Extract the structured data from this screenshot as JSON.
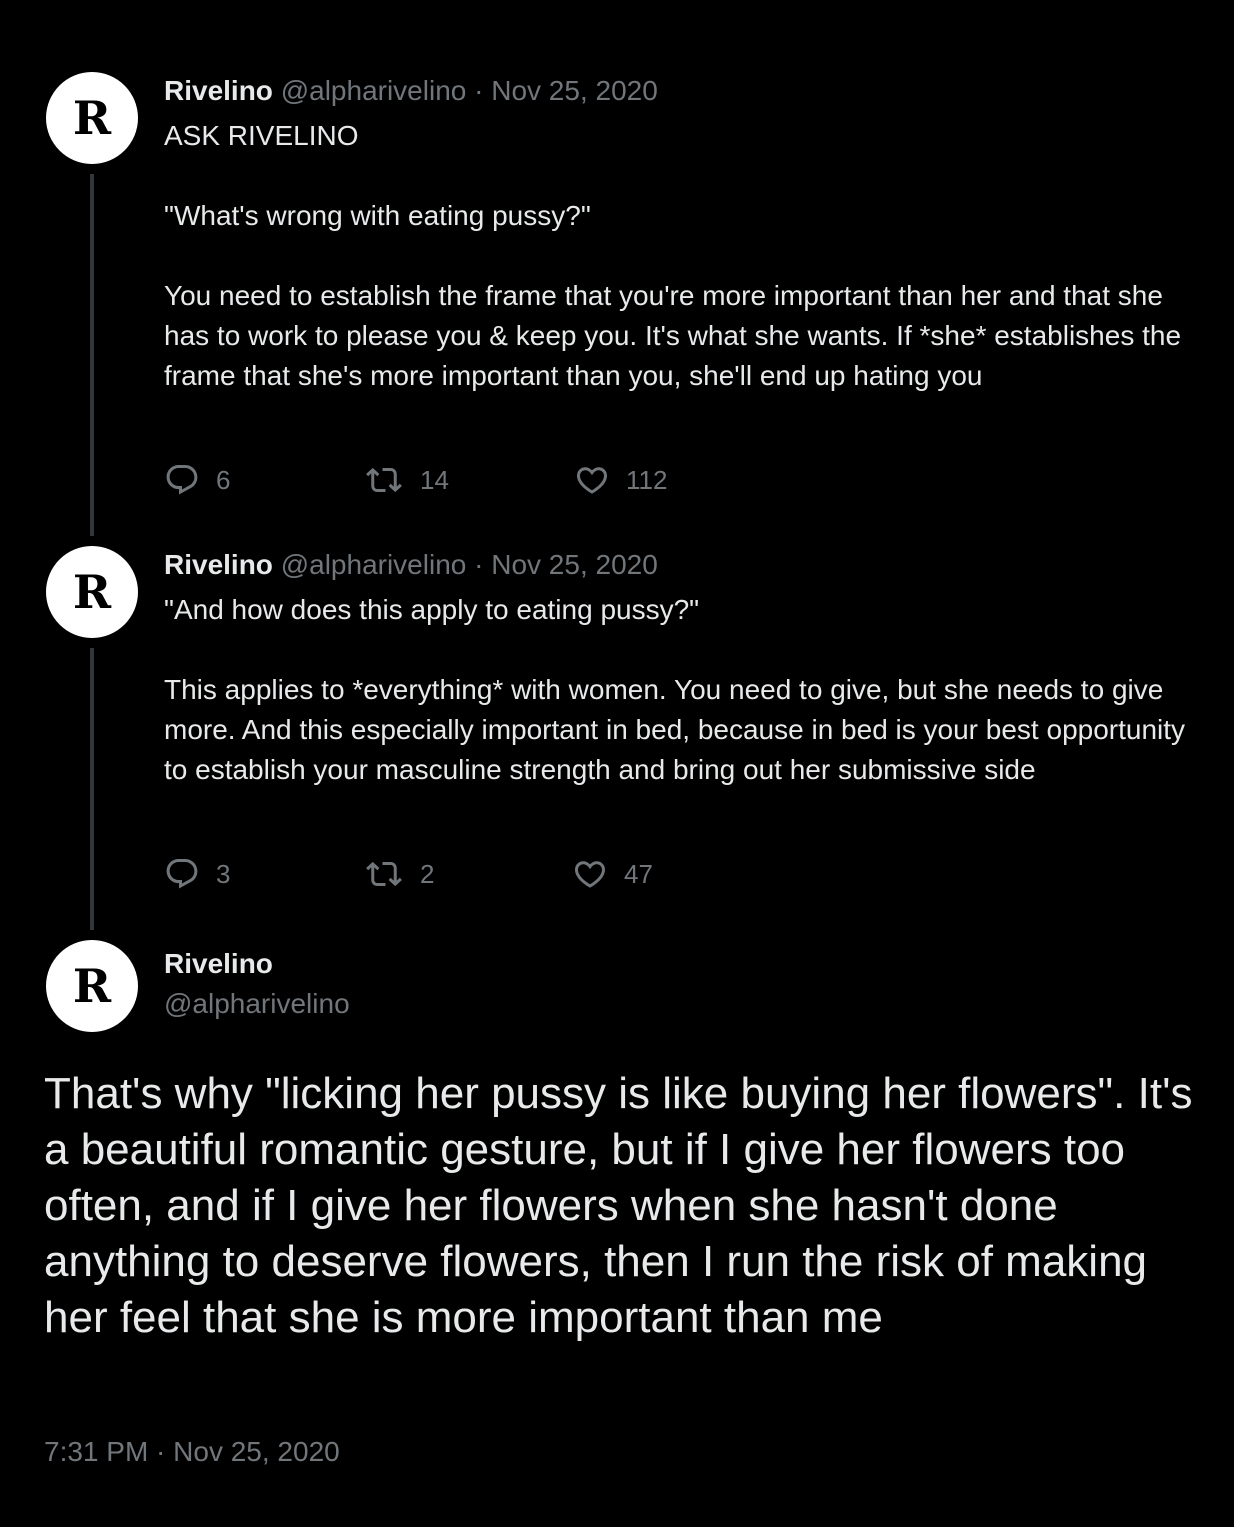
{
  "colors": {
    "background": "#000000",
    "text_primary": "#e7e9ea",
    "text_secondary": "#71767b",
    "thread_line": "#333639",
    "avatar_bg": "#ffffff"
  },
  "avatar": {
    "letter": "R"
  },
  "tweets": [
    {
      "name": "Rivelino",
      "handle": "@alpharivelino",
      "separator": "·",
      "date": "Nov 25, 2020",
      "paragraphs": [
        "ASK RIVELINO",
        "\"What's wrong with eating pussy?\"",
        "You need to establish the frame that you're more important than her and that she has to work to please you & keep you. It's what she wants. If *she* establishes the frame that she's more important than you, she'll end up hating you"
      ],
      "replies": "6",
      "retweets": "14",
      "likes": "112"
    },
    {
      "name": "Rivelino",
      "handle": "@alpharivelino",
      "separator": "·",
      "date": "Nov 25, 2020",
      "paragraphs": [
        "\"And how does this apply to eating pussy?\"",
        "This applies to *everything* with women. You need to give, but she needs to give more. And this especially important in bed, because in bed is your best opportunity to establish your masculine strength and bring out her submissive side"
      ],
      "replies": "3",
      "retweets": "2",
      "likes": "47"
    }
  ],
  "focus_tweet": {
    "name": "Rivelino",
    "handle": "@alpharivelino",
    "text": "That's why \"licking her pussy is like buying her flowers\". It's a beautiful romantic gesture, but if I give her flowers too often, and if I give her flowers when she hasn't done anything to deserve flowers, then I run the risk of making her feel that she is more important than me",
    "timestamp": "7:31 PM · Nov 25, 2020"
  },
  "icons": {
    "reply": "reply-icon",
    "retweet": "retweet-icon",
    "like": "heart-icon"
  }
}
